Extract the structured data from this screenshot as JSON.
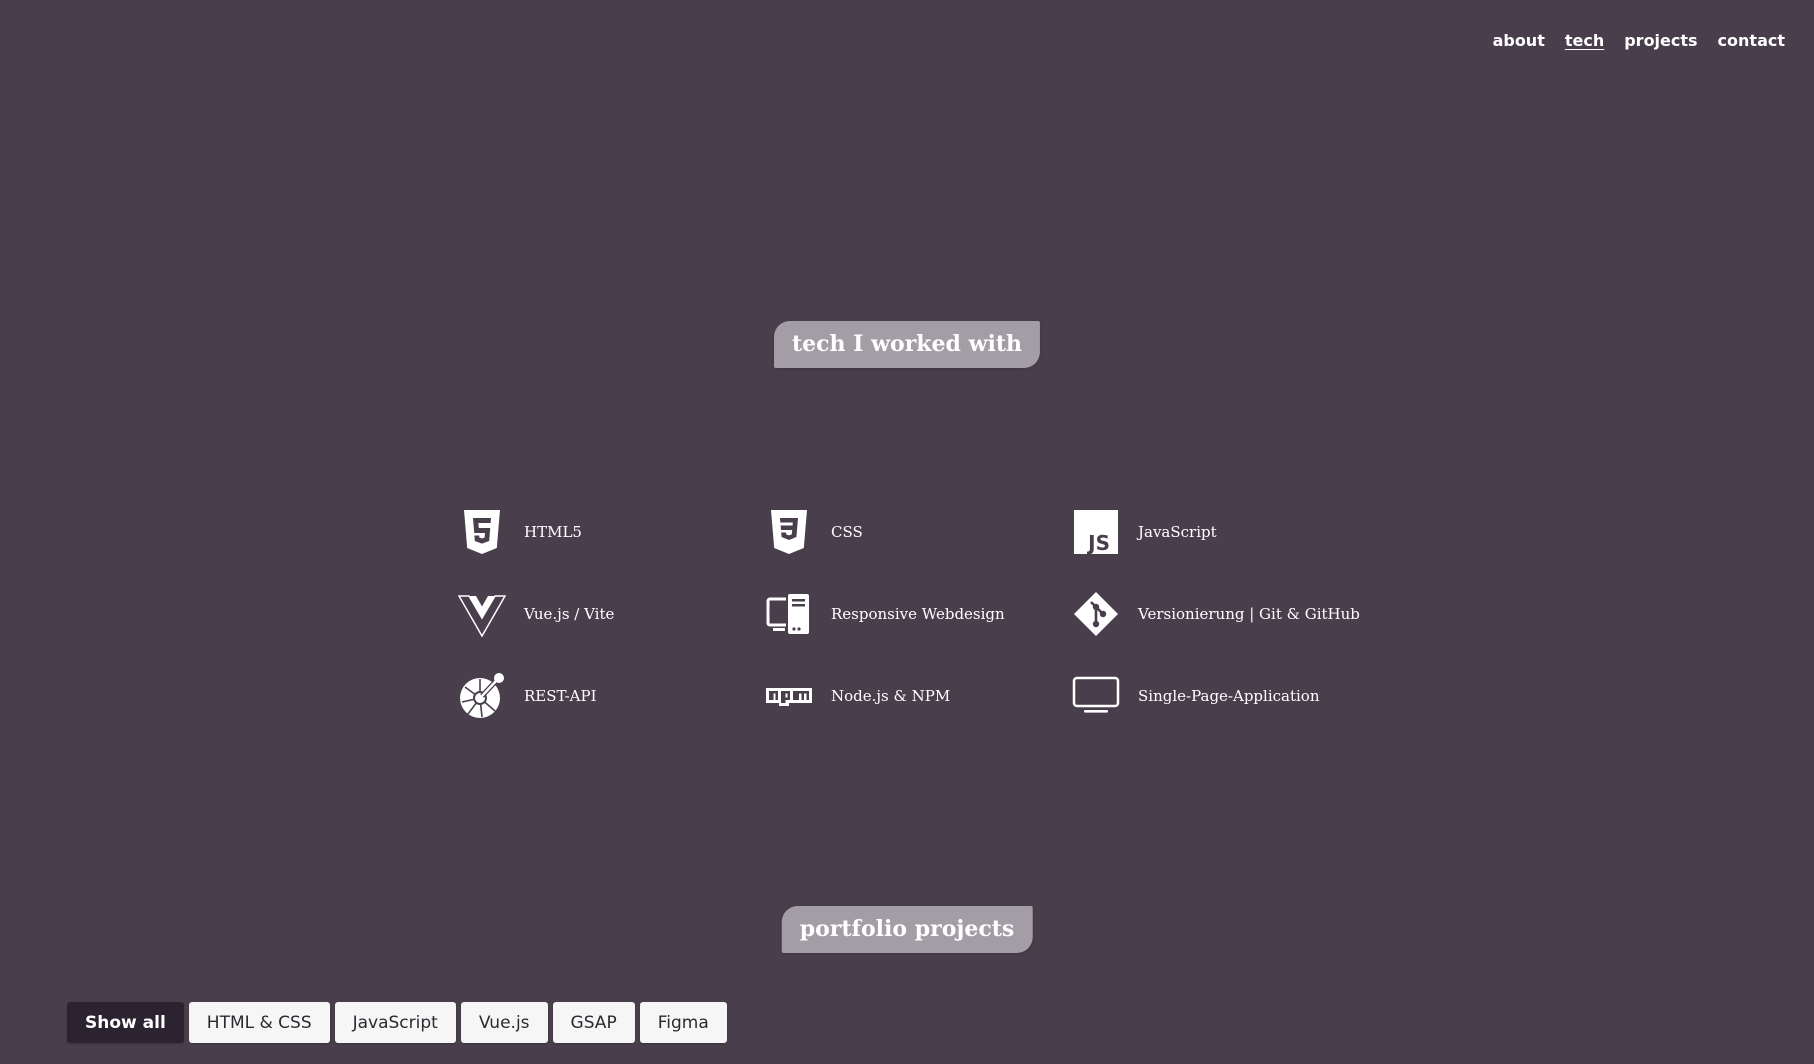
{
  "nav": {
    "items": [
      {
        "label": "about",
        "active": false
      },
      {
        "label": "tech",
        "active": true
      },
      {
        "label": "projects",
        "active": false
      },
      {
        "label": "contact",
        "active": false
      }
    ]
  },
  "tech_section": {
    "title": "tech I worked with",
    "items": [
      {
        "label": "HTML5",
        "icon": "html5-icon"
      },
      {
        "label": "CSS",
        "icon": "css3-icon"
      },
      {
        "label": "JavaScript",
        "icon": "javascript-icon"
      },
      {
        "label": "Vue.js / Vite",
        "icon": "vuejs-icon"
      },
      {
        "label": "Responsive Webdesign",
        "icon": "responsive-devices-icon"
      },
      {
        "label": "Versionierung | Git & GitHub",
        "icon": "git-icon"
      },
      {
        "label": "REST-API",
        "icon": "api-icon"
      },
      {
        "label": "Node.js & NPM",
        "icon": "npm-icon"
      },
      {
        "label": "Single-Page-Application",
        "icon": "monitor-icon"
      }
    ]
  },
  "projects_section": {
    "title": "portfolio projects",
    "filters": [
      {
        "label": "Show all",
        "active": true
      },
      {
        "label": "HTML & CSS",
        "active": false
      },
      {
        "label": "JavaScript",
        "active": false
      },
      {
        "label": "Vue.js",
        "active": false
      },
      {
        "label": "GSAP",
        "active": false
      },
      {
        "label": "Figma",
        "active": false
      }
    ]
  },
  "colors": {
    "background": "#493f4c",
    "title_badge": "#a39da6",
    "active_filter": "#2b2430",
    "filter_button": "#f6f6f6"
  }
}
